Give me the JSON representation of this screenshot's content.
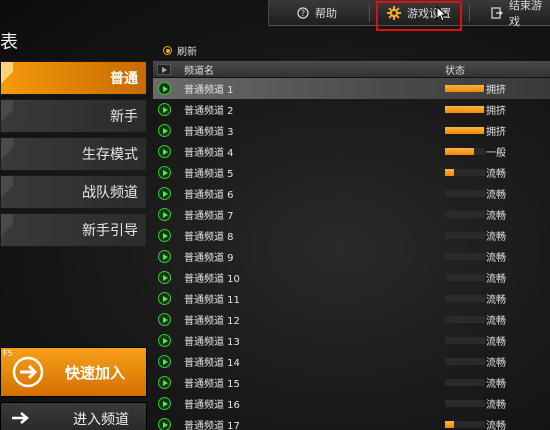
{
  "title": "表",
  "topbar": {
    "help_label": "帮助",
    "settings_label": "游戏设置",
    "exit_label": "结束游戏"
  },
  "refresh_label": "刷新",
  "sidebar": {
    "items": [
      {
        "label": "普通",
        "active": true
      },
      {
        "label": "新手",
        "active": false
      },
      {
        "label": "生存模式",
        "active": false
      },
      {
        "label": "战队频道",
        "active": false
      },
      {
        "label": "新手引导",
        "active": false
      }
    ],
    "quick_join": {
      "key": "F5",
      "label": "快速加入"
    },
    "enter_channel": {
      "label": "进入频道"
    }
  },
  "list": {
    "header": {
      "name": "频道名",
      "status": "状态"
    },
    "rows": [
      {
        "name": "普通频道 1",
        "status": "拥挤",
        "load": 0.98
      },
      {
        "name": "普通频道 2",
        "status": "拥挤",
        "load": 0.98
      },
      {
        "name": "普通频道 3",
        "status": "拥挤",
        "load": 0.98
      },
      {
        "name": "普通频道 4",
        "status": "一般",
        "load": 0.72
      },
      {
        "name": "普通频道 5",
        "status": "流畅",
        "load": 0.22
      },
      {
        "name": "普通频道 6",
        "status": "流畅",
        "load": 0
      },
      {
        "name": "普通频道 7",
        "status": "流畅",
        "load": 0
      },
      {
        "name": "普通频道 8",
        "status": "流畅",
        "load": 0
      },
      {
        "name": "普通频道 9",
        "status": "流畅",
        "load": 0
      },
      {
        "name": "普通频道 10",
        "status": "流畅",
        "load": 0
      },
      {
        "name": "普通频道 11",
        "status": "流畅",
        "load": 0
      },
      {
        "name": "普通频道 12",
        "status": "流畅",
        "load": 0
      },
      {
        "name": "普通频道 13",
        "status": "流畅",
        "load": 0
      },
      {
        "name": "普通频道 14",
        "status": "流畅",
        "load": 0
      },
      {
        "name": "普通频道 15",
        "status": "流畅",
        "load": 0
      },
      {
        "name": "普通频道 16",
        "status": "流畅",
        "load": 0
      },
      {
        "name": "普通频道 17",
        "status": "流畅",
        "load": 0.22
      }
    ]
  },
  "colors": {
    "accent": "#f59a0c",
    "play_green": "#3fc23f",
    "highlight": "#e01010"
  },
  "icons": {
    "help": "help-icon",
    "settings": "gear-icon",
    "exit": "exit-icon",
    "quick_join": "arrow-circle-icon",
    "enter": "arrow-right-icon"
  }
}
